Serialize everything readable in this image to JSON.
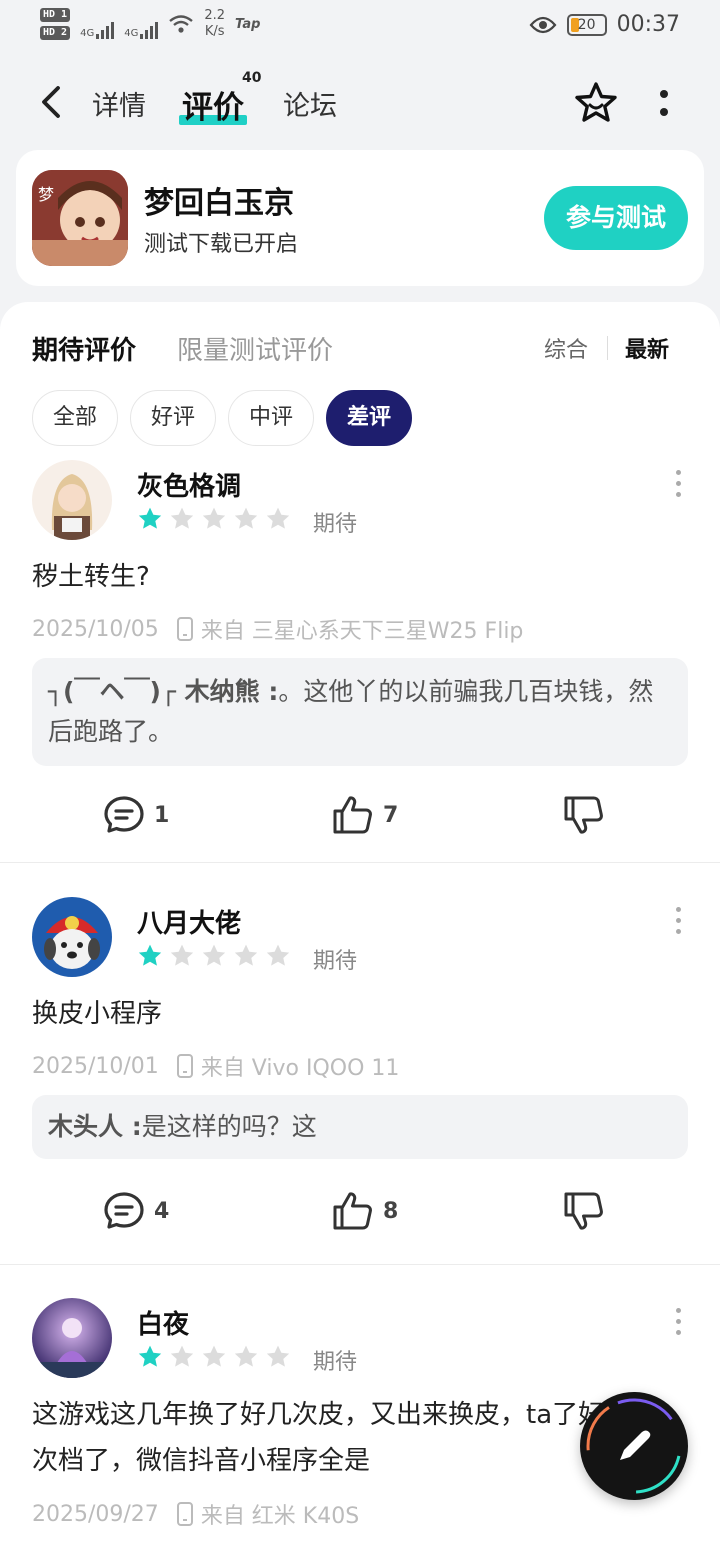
{
  "status_bar": {
    "hd1": "HD 1",
    "hd2": "HD 2",
    "net1": "4G",
    "net2": "4G",
    "speed_value": "2.2",
    "speed_unit": "K/s",
    "tap_logo": "Tap",
    "battery": "20",
    "time": "00:37"
  },
  "nav": {
    "tabs": [
      {
        "label": "详情"
      },
      {
        "label": "评价"
      },
      {
        "label": "论坛"
      }
    ],
    "review_count": "40"
  },
  "game": {
    "name": "梦回白玉京",
    "subtitle": "测试下载已开启",
    "join_label": "参与测试"
  },
  "review_tabs": {
    "primary": "期待评价",
    "secondary": "限量测试评价",
    "sort_options": [
      "综合",
      "最新"
    ]
  },
  "filters": [
    "全部",
    "好评",
    "中评",
    "差评"
  ],
  "reviews": [
    {
      "user": "灰色格调",
      "rating": 1,
      "label": "期待",
      "text": "秽土转生?",
      "date": "2025/10/05",
      "source": "来自 三星心系天下三星W25 Flip",
      "reply_author": "┐(￣ヘ￣)┌ 木纳熊 :",
      "reply_text": "。这他丫的以前骗我几百块钱，然后跑路了。",
      "comments": "1",
      "likes": "7"
    },
    {
      "user": "八月大佬",
      "rating": 1,
      "label": "期待",
      "text": "换皮小程序",
      "date": "2025/10/01",
      "source": "来自 Vivo IQOO 11",
      "reply_author": "木头人 :",
      "reply_text": "是这样的吗？这",
      "comments": "4",
      "likes": "8"
    },
    {
      "user": "白夜",
      "rating": 1,
      "label": "期待",
      "text": "这游戏这几年换了好几次皮，又出来换皮，ta了好几次档了，微信抖音小程序全是",
      "date": "2025/09/27",
      "source": "来自 红米 K40S"
    }
  ],
  "colors": {
    "accent": "#1fd1c3",
    "chip_active": "#1e1e6e",
    "star_on": "#1fd1c3",
    "star_off": "#dcdcdc"
  }
}
